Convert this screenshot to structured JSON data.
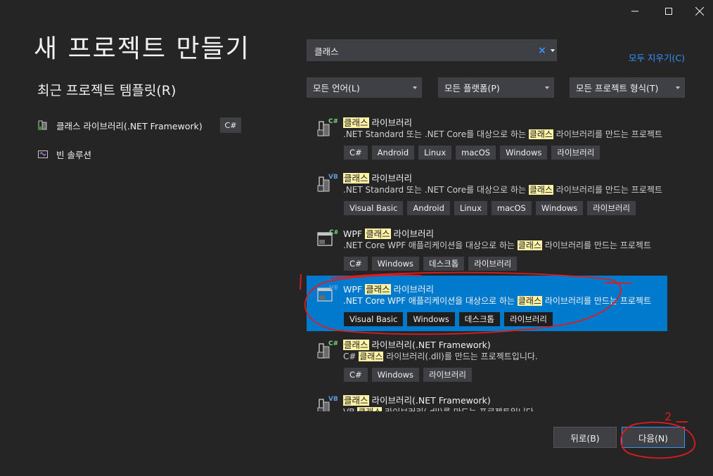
{
  "window": {
    "controls": [
      "minimize-icon",
      "maximize-icon",
      "close-icon"
    ]
  },
  "header": {
    "title": "새 프로젝트 만들기",
    "recent_title": "최근 프로젝트 템플릿(R)"
  },
  "recent": [
    {
      "label": "클래스 라이브러리(.NET Framework)",
      "badge": "C#",
      "icon": "class-library-icon"
    },
    {
      "label": "빈 솔루션",
      "icon": "blank-solution-icon"
    }
  ],
  "search": {
    "value": "클래스",
    "clear_glyph": "×",
    "clear_all": "모두 지우기(C)"
  },
  "filters": {
    "language": "모든 언어(L)",
    "platform": "모든 플랫폼(P)",
    "project_type": "모든 프로젝트 형식(T)"
  },
  "templates": [
    {
      "lang": "C#",
      "name": [
        "",
        "클래스",
        " 라이브러리"
      ],
      "desc": [
        ".NET Standard 또는 .NET Core를 대상으로 하는 ",
        "클래스",
        " 라이브러리를 만드는 프로젝트"
      ],
      "tags": [
        "C#",
        "Android",
        "Linux",
        "macOS",
        "Windows",
        "라이브러리"
      ]
    },
    {
      "lang": "VB",
      "name": [
        "",
        "클래스",
        " 라이브러리"
      ],
      "desc": [
        ".NET Standard 또는 .NET Core를 대상으로 하는 ",
        "클래스",
        " 라이브러리를 만드는 프로젝트"
      ],
      "tags": [
        "Visual Basic",
        "Android",
        "Linux",
        "macOS",
        "Windows",
        "라이브러리"
      ]
    },
    {
      "lang": "C#",
      "name": [
        "WPF ",
        "클래스",
        " 라이브러리"
      ],
      "desc": [
        ".NET Core WPF 애플리케이션을 대상으로 하는 ",
        "클래스",
        " 라이브러리를 만드는 프로젝트"
      ],
      "tags": [
        "C#",
        "Windows",
        "데스크톱",
        "라이브러리"
      ]
    },
    {
      "lang": "VB",
      "name": [
        "WPF ",
        "클래스",
        " 라이브러리"
      ],
      "desc": [
        ".NET Core WPF 애플리케이션을 대상으로 하는 ",
        "클래스",
        " 라이브러리를 만드는 프로젝트"
      ],
      "tags": [
        "Visual Basic",
        "Windows",
        "데스크톱",
        "라이브러리"
      ],
      "selected": true
    },
    {
      "lang": "C#",
      "name": [
        "",
        "클래스",
        " 라이브러리(.NET Framework)"
      ],
      "desc": [
        "C# ",
        "클래스",
        " 라이브러리(.dll)를 만드는 프로젝트입니다."
      ],
      "tags": [
        "C#",
        "Windows",
        "라이브러리"
      ]
    },
    {
      "lang": "VB",
      "name": [
        "",
        "클래스",
        " 라이브러리(.NET Framework)"
      ],
      "desc": [
        "VB ",
        "클래스",
        " 라이브러리(.dll)를 만드는 프로젝트입니다."
      ],
      "tags": []
    }
  ],
  "buttons": {
    "back": "뒤로(B)",
    "next": "다음(N)"
  },
  "annotations": {
    "step_label": "2",
    "color": "#e01b1b"
  },
  "colors": {
    "background": "#252526",
    "selection": "#007acc",
    "accent": "#3794ff",
    "highlight": "#fff3a6"
  }
}
